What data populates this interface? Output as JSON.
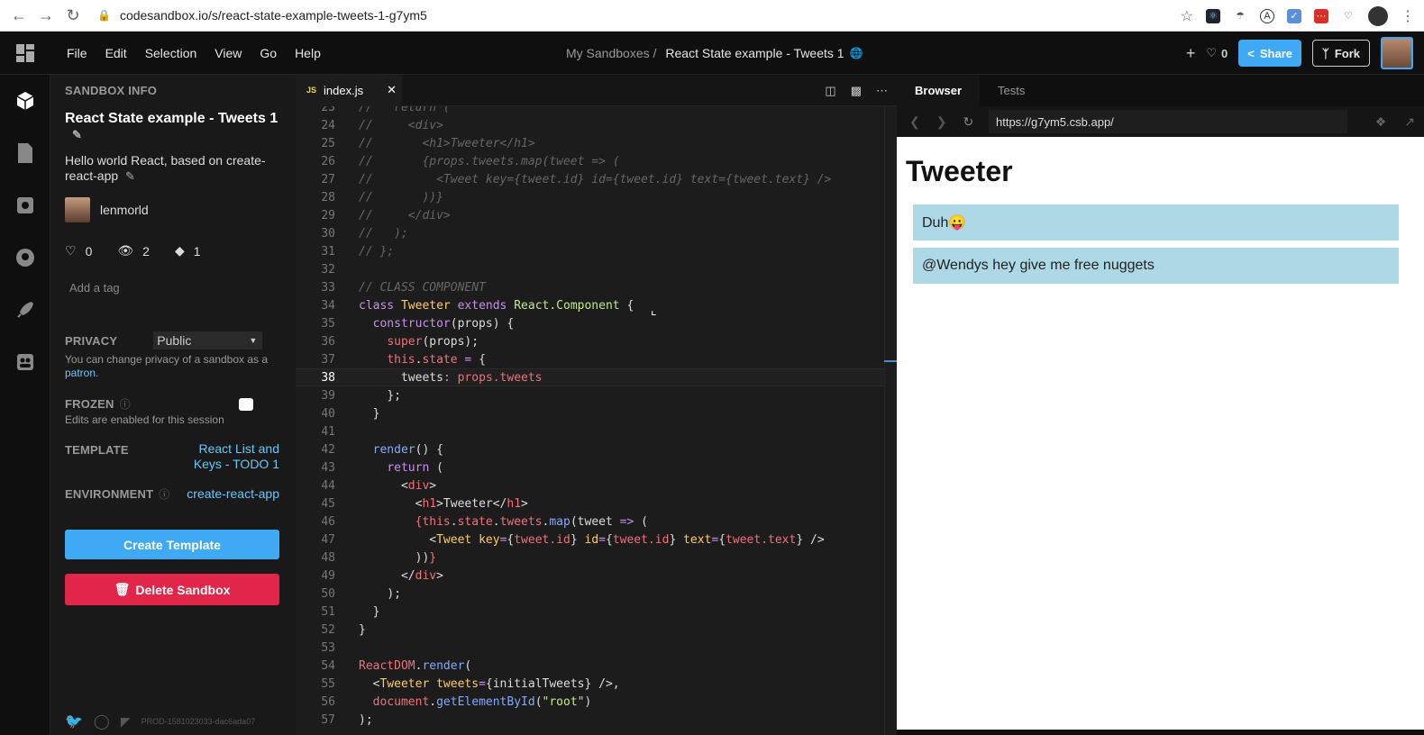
{
  "browser": {
    "url": "codesandbox.io/s/react-state-example-tweets-1-g7ym5"
  },
  "header": {
    "menu": [
      "File",
      "Edit",
      "Selection",
      "View",
      "Go",
      "Help"
    ],
    "breadcrumb": "My Sandboxes /",
    "sandbox_title": "React State example - Tweets 1",
    "likes": "0",
    "share_label": "Share",
    "fork_label": "Fork"
  },
  "sidebar": {
    "section_title": "SANDBOX INFO",
    "name": "React State example - Tweets 1",
    "description": "Hello world React, based on create-react-app",
    "user": "lenmorld",
    "likes": "0",
    "views": "2",
    "forks": "1",
    "add_tag": "Add a tag",
    "privacy_label": "PRIVACY",
    "privacy_value": "Public",
    "privacy_note_prefix": "You can change privacy of a sandbox as a ",
    "privacy_note_link": "patron",
    "privacy_note_suffix": ".",
    "frozen_label": "FROZEN",
    "frozen_note": "Edits are enabled for this session",
    "template_label": "TEMPLATE",
    "template_value": "React List and Keys - TODO 1",
    "environment_label": "ENVIRONMENT",
    "environment_value": "create-react-app",
    "create_template": "Create Template",
    "delete_sandbox": "Delete Sandbox",
    "footer_build": "PROD-1581023033-dac6ada07"
  },
  "editor": {
    "tab": "index.js",
    "tab_badge": "JS",
    "current_line": "38"
  },
  "preview": {
    "tabs": [
      "Browser",
      "Tests"
    ],
    "url": "https://g7ym5.csb.app/",
    "heading": "Tweeter",
    "tweets": [
      "Duh😛",
      "@Wendys hey give me free nuggets"
    ]
  },
  "colors": {
    "accent": "#40a9f3",
    "danger": "#e1264a",
    "tweet_bg": "#add8e6"
  }
}
